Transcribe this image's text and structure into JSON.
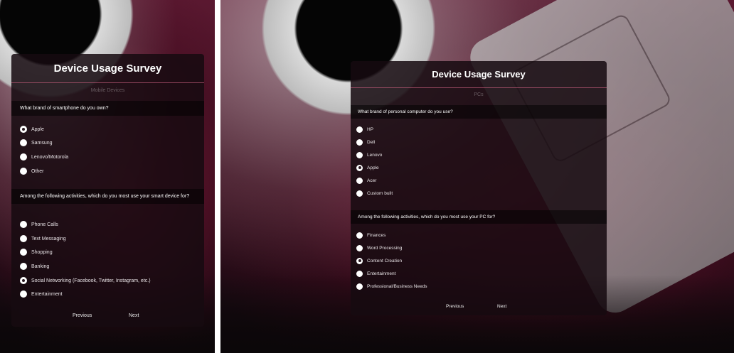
{
  "left": {
    "title": "Device Usage Survey",
    "page_label": "Mobile Devices",
    "q1": {
      "text": "What brand of smartphone do you own?",
      "options": [
        {
          "label": "Apple",
          "selected": true
        },
        {
          "label": "Samsung",
          "selected": false
        },
        {
          "label": "Lenovo/Motorola",
          "selected": false
        },
        {
          "label": "Other",
          "selected": false
        }
      ]
    },
    "q2": {
      "text": "Among the following activities, which do you most use your smart device for?",
      "options": [
        {
          "label": "Phone Calls",
          "selected": false
        },
        {
          "label": "Text Messaging",
          "selected": false
        },
        {
          "label": "Shopping",
          "selected": false
        },
        {
          "label": "Banking",
          "selected": false
        },
        {
          "label": "Social Networking (Facebook, Twitter, Instagram, etc.)",
          "selected": true
        },
        {
          "label": "Entertainment",
          "selected": false
        }
      ]
    },
    "prev_label": "Previous",
    "next_label": "Next"
  },
  "right": {
    "title": "Device Usage Survey",
    "page_label": "PCs",
    "q1": {
      "text": "What brand of personal computer do you use?",
      "options": [
        {
          "label": "HP",
          "selected": false
        },
        {
          "label": "Dell",
          "selected": false
        },
        {
          "label": "Lenovo",
          "selected": false
        },
        {
          "label": "Apple",
          "selected": true
        },
        {
          "label": "Acer",
          "selected": false
        },
        {
          "label": "Custom built",
          "selected": false
        }
      ]
    },
    "q2": {
      "text": "Among the following activities, which do you most use your PC for?",
      "options": [
        {
          "label": "Finances",
          "selected": false
        },
        {
          "label": "Word Processing",
          "selected": false
        },
        {
          "label": "Content Creation",
          "selected": true
        },
        {
          "label": "Entertainment",
          "selected": false
        },
        {
          "label": "Professional/Business Needs",
          "selected": false
        }
      ]
    },
    "prev_label": "Previous",
    "next_label": "Next"
  },
  "colors": {
    "card_bg": "#160a10",
    "accent_rule": "#be5a78",
    "radio": "#ffffff"
  }
}
